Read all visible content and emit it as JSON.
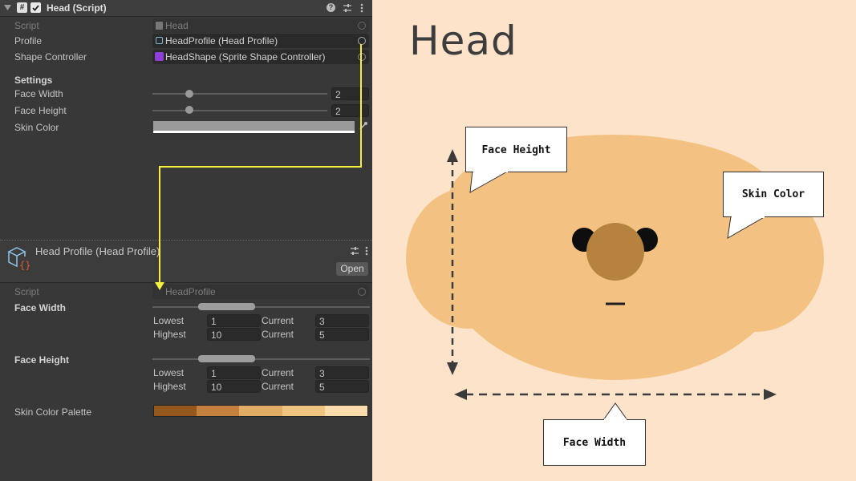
{
  "component": {
    "title": "Head (Script)"
  },
  "script_row": {
    "label": "Script",
    "value": "Head"
  },
  "profile_row": {
    "label": "Profile",
    "value": "HeadProfile (Head Profile)"
  },
  "shape_row": {
    "label": "Shape Controller",
    "value": "HeadShape (Sprite Shape Controller)"
  },
  "settings": {
    "header": "Settings",
    "face_width": {
      "label": "Face Width",
      "value": "2",
      "slider_fraction": 0.25
    },
    "face_height": {
      "label": "Face Height",
      "value": "2",
      "slider_fraction": 0.25
    },
    "skin_color": {
      "label": "Skin Color",
      "color": "#9a9a9a"
    }
  },
  "asset": {
    "title": "Head Profile (Head Profile)",
    "open_label": "Open",
    "script_label": "Script",
    "script_value": "HeadProfile"
  },
  "profile_face_width": {
    "label": "Face Width",
    "lowest_label": "Lowest",
    "lowest": "1",
    "current1_label": "Current",
    "current1": "3",
    "highest_label": "Highest",
    "highest": "10",
    "current2_label": "Current",
    "current2": "5"
  },
  "profile_face_height": {
    "label": "Face Height",
    "lowest_label": "Lowest",
    "lowest": "1",
    "current1_label": "Current",
    "current1": "3",
    "highest_label": "Highest",
    "highest": "10",
    "current2_label": "Current",
    "current2": "5"
  },
  "palette": {
    "label": "Skin Color Palette",
    "colors": [
      "#94581f",
      "#c4803f",
      "#e0ac66",
      "#efc380",
      "#fbdcac"
    ]
  },
  "illustration": {
    "title": "Head",
    "callouts": {
      "face_height": "Face Height",
      "skin_color": "Skin Color",
      "face_width": "Face Width"
    },
    "colors": {
      "background": "#fde3c9",
      "skin": "#f3c283",
      "nose": "#b5833e",
      "arrow_link": "#f4f040"
    }
  },
  "icons": [
    "foldout-arrow-icon",
    "script-icon",
    "checkbox-icon",
    "help-icon",
    "presets-icon",
    "kebab-menu-icon",
    "object-picker-icon",
    "eyedropper-icon",
    "scriptable-object-icon"
  ]
}
